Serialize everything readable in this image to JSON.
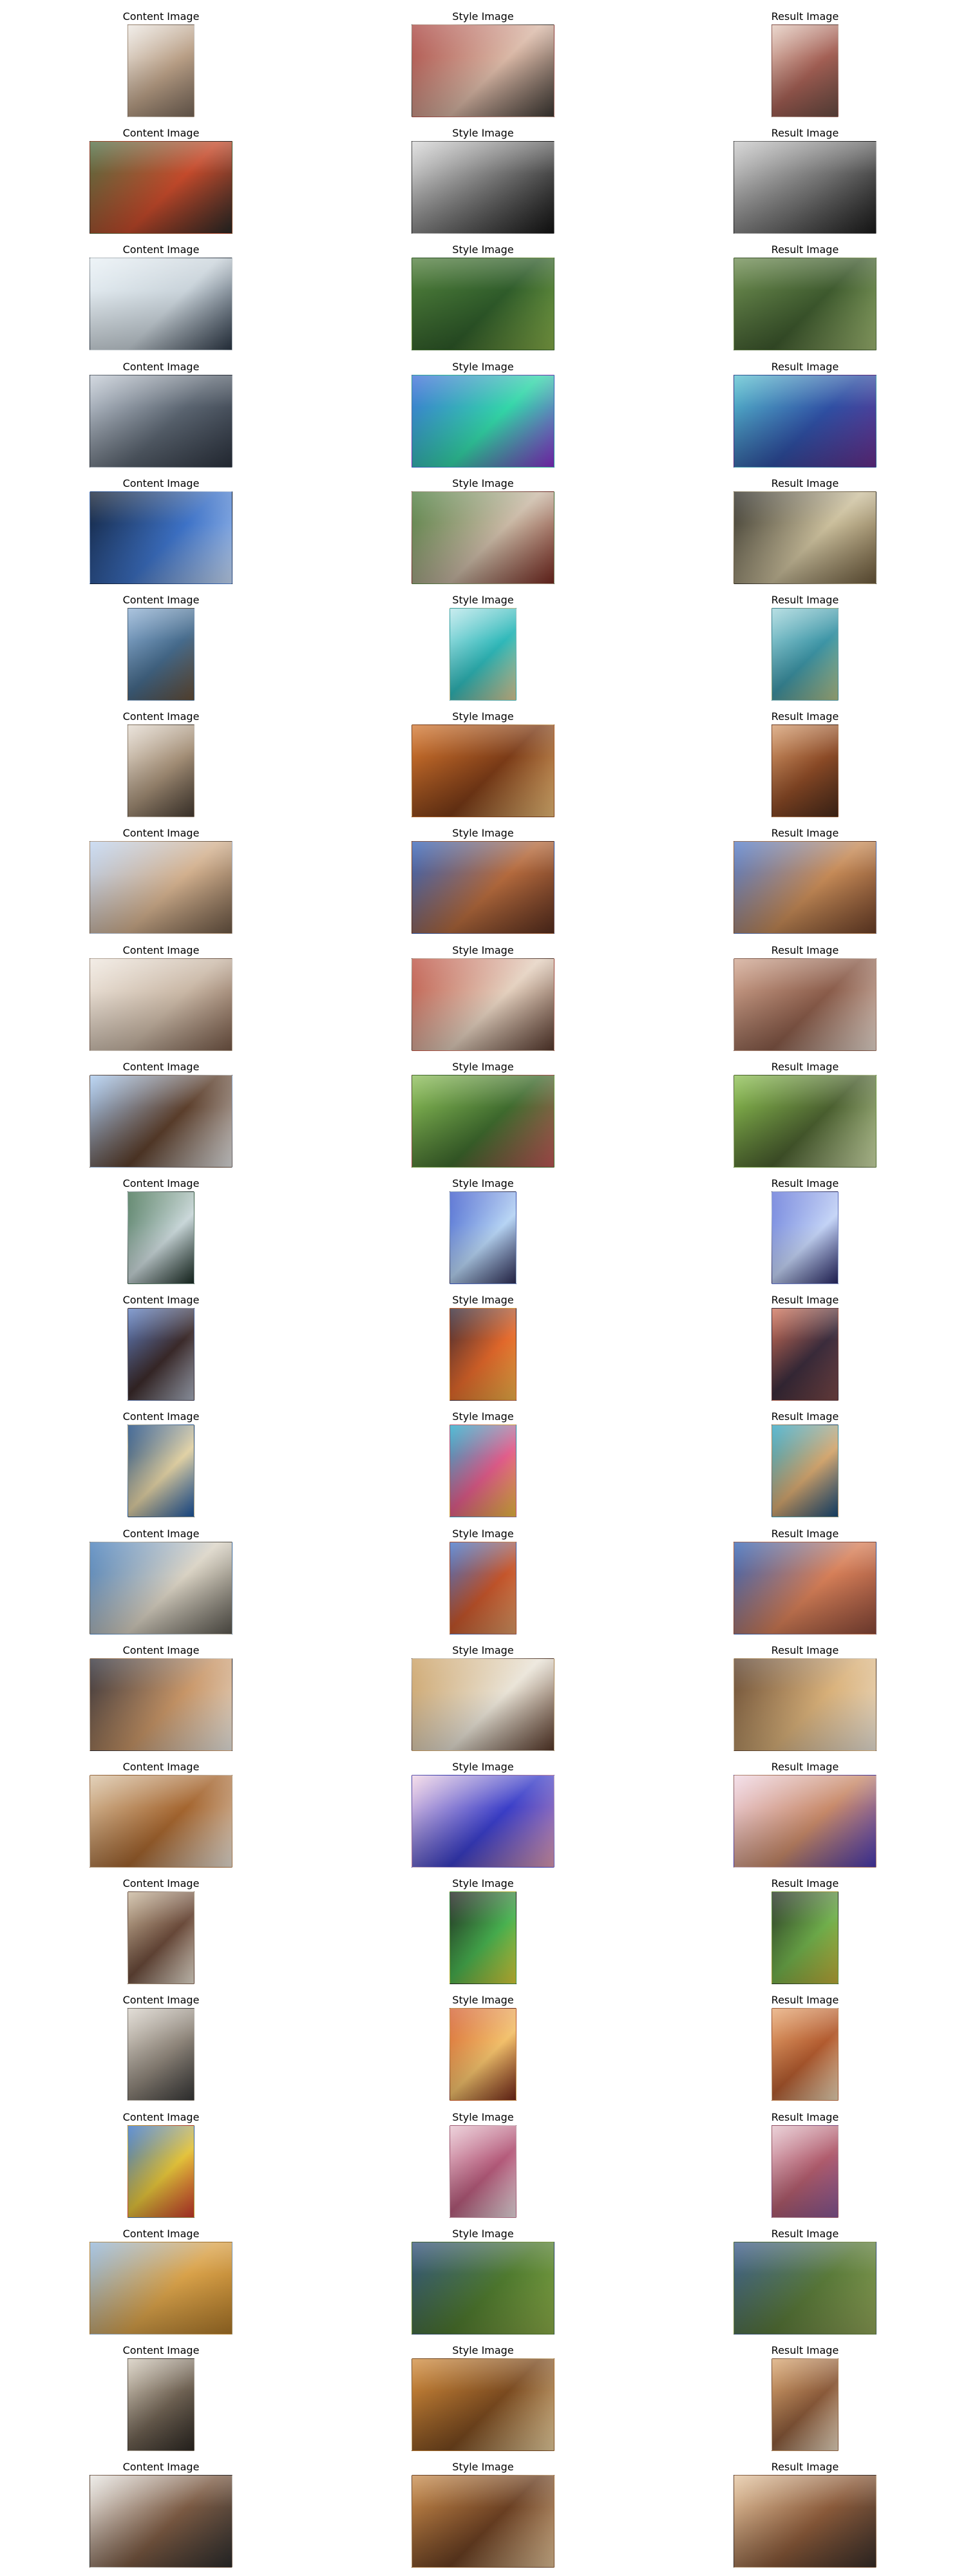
{
  "labels": {
    "content": "Content Image",
    "style": "Style Image",
    "result": "Result Image"
  },
  "rows": [
    {
      "content": {
        "shape": "portrait",
        "colors": [
          "#ece7e1",
          "#b99f86",
          "#7b6a5c"
        ]
      },
      "style": {
        "shape": "landscape",
        "colors": [
          "#a8433e",
          "#d9b7a5",
          "#3f3a35"
        ]
      },
      "result": {
        "shape": "portrait",
        "colors": [
          "#e3c9bc",
          "#a35f54",
          "#6a4d44"
        ]
      }
    },
    {
      "content": {
        "shape": "landscape",
        "colors": [
          "#4b6a3e",
          "#c44a2b",
          "#2b2a27"
        ]
      },
      "style": {
        "shape": "landscape",
        "colors": [
          "#d7d7d7",
          "#6c6c6c",
          "#141414"
        ]
      },
      "result": {
        "shape": "landscape",
        "colors": [
          "#c9c9c9",
          "#6f6f6f",
          "#1b1b1b"
        ]
      }
    },
    {
      "content": {
        "shape": "landscape",
        "colors": [
          "#e8f0f5",
          "#c9d3da",
          "#2f3b4a"
        ]
      },
      "style": {
        "shape": "landscape",
        "colors": [
          "#4f7d3a",
          "#2f5c2a",
          "#8ab24b"
        ]
      },
      "result": {
        "shape": "landscape",
        "colors": [
          "#6c8b4f",
          "#3e5a2e",
          "#a3bd75"
        ]
      }
    },
    {
      "content": {
        "shape": "landscape",
        "colors": [
          "#c3cbd5",
          "#5a6470",
          "#2d3440"
        ]
      },
      "style": {
        "shape": "landscape",
        "colors": [
          "#3b6bd8",
          "#33d6a8",
          "#8d2fd2"
        ]
      },
      "result": {
        "shape": "landscape",
        "colors": [
          "#58c0cf",
          "#2f4fa3",
          "#6b2f8f"
        ]
      }
    },
    {
      "content": {
        "shape": "landscape",
        "colors": [
          "#0e1b2f",
          "#3d72c7",
          "#cfe3ff"
        ]
      },
      "style": {
        "shape": "landscape",
        "colors": [
          "#4a7a3a",
          "#c9b8a4",
          "#7a2b22"
        ]
      },
      "result": {
        "shape": "landscape",
        "colors": [
          "#2b2a23",
          "#cbbf9c",
          "#6f5c3d"
        ]
      }
    },
    {
      "content": {
        "shape": "portrait",
        "colors": [
          "#8fb0d3",
          "#466b8c",
          "#6a523a"
        ]
      },
      "style": {
        "shape": "portrait",
        "colors": [
          "#b6e6ea",
          "#2fb8b9",
          "#e8d39a"
        ]
      },
      "result": {
        "shape": "portrait",
        "colors": [
          "#9fd4da",
          "#3d95a6",
          "#b9c88d"
        ]
      }
    },
    {
      "content": {
        "shape": "portrait",
        "colors": [
          "#e3dacf",
          "#a38e76",
          "#4a3f35"
        ]
      },
      "style": {
        "shape": "landscape",
        "colors": [
          "#d3762e",
          "#7b3b17",
          "#f1c17a"
        ]
      },
      "result": {
        "shape": "portrait",
        "colors": [
          "#d49a6b",
          "#8b4a26",
          "#4a2b1b"
        ]
      }
    },
    {
      "content": {
        "shape": "landscape",
        "colors": [
          "#bcd2ef",
          "#d2b08e",
          "#6f5a47"
        ]
      },
      "style": {
        "shape": "landscape",
        "colors": [
          "#2f5fb8",
          "#b46a3d",
          "#5a2f1f"
        ]
      },
      "result": {
        "shape": "landscape",
        "colors": [
          "#4f78c8",
          "#c58a57",
          "#6f4129"
        ]
      }
    },
    {
      "content": {
        "shape": "landscape",
        "colors": [
          "#efe7de",
          "#c9b7a5",
          "#7a5c4a"
        ]
      },
      "style": {
        "shape": "landscape",
        "colors": [
          "#b94a3a",
          "#e4d0be",
          "#5a3b2f"
        ]
      },
      "result": {
        "shape": "landscape",
        "colors": [
          "#d0a58f",
          "#8a5c4a",
          "#f0e1d6"
        ]
      }
    },
    {
      "content": {
        "shape": "landscape",
        "colors": [
          "#a7c9f0",
          "#5c3f2c",
          "#e9e9e9"
        ]
      },
      "style": {
        "shape": "landscape",
        "colors": [
          "#8bbd56",
          "#3f6b2e",
          "#c65a5a"
        ]
      },
      "result": {
        "shape": "landscape",
        "colors": [
          "#8bbf4f",
          "#4a5f2f",
          "#d7e6b0"
        ]
      }
    },
    {
      "content": {
        "shape": "portrait",
        "colors": [
          "#3b6a4a",
          "#c8d6d8",
          "#1b2e26"
        ]
      },
      "style": {
        "shape": "portrait",
        "colors": [
          "#3654c9",
          "#b6d4f4",
          "#2f2f5a"
        ]
      },
      "result": {
        "shape": "portrait",
        "colors": [
          "#5b6fd6",
          "#c3d3f6",
          "#2a2a6a"
        ]
      }
    },
    {
      "content": {
        "shape": "portrait",
        "colors": [
          "#5d7ec1",
          "#3b2a2a",
          "#b0b7c7"
        ]
      },
      "style": {
        "shape": "portrait",
        "colors": [
          "#2a1f2f",
          "#e2682b",
          "#f7b84b"
        ]
      },
      "result": {
        "shape": "portrait",
        "colors": [
          "#cf6f55",
          "#3b2c3c",
          "#7f4b4b"
        ]
      }
    },
    {
      "content": {
        "shape": "portrait",
        "colors": [
          "#0f3f7a",
          "#e0d0a3",
          "#1e5aa8"
        ]
      },
      "style": {
        "shape": "portrait",
        "colors": [
          "#1ea6c7",
          "#e05c8a",
          "#f2c243"
        ]
      },
      "result": {
        "shape": "portrait",
        "colors": [
          "#2aa2c2",
          "#d3a66f",
          "#1a4f7f"
        ]
      }
    },
    {
      "content": {
        "shape": "landscape",
        "colors": [
          "#3f78b7",
          "#d9d2c3",
          "#5d5a52"
        ]
      },
      "style": {
        "shape": "portrait",
        "colors": [
          "#3c6ec7",
          "#c4552b",
          "#e4a06a"
        ]
      },
      "result": {
        "shape": "landscape",
        "colors": [
          "#2f5fb3",
          "#d67f58",
          "#8c4a3a"
        ]
      }
    },
    {
      "content": {
        "shape": "landscape",
        "colors": [
          "#2a2a34",
          "#c89668",
          "#f1efe9"
        ]
      },
      "style": {
        "shape": "landscape",
        "colors": [
          "#c79a5a",
          "#e9e3d6",
          "#5a3a2a"
        ]
      },
      "result": {
        "shape": "landscape",
        "colors": [
          "#5a3f2b",
          "#d9b17a",
          "#f2ebdf"
        ]
      }
    },
    {
      "content": {
        "shape": "landscape",
        "colors": [
          "#d9c2a3",
          "#a4652f",
          "#efe7dc"
        ]
      },
      "style": {
        "shape": "landscape",
        "colors": [
          "#f1d3e4",
          "#3a3ec8",
          "#e6a0b8"
        ]
      },
      "result": {
        "shape": "landscape",
        "colors": [
          "#f0d6e3",
          "#c88a6a",
          "#4b3bb8"
        ]
      }
    },
    {
      "content": {
        "shape": "portrait",
        "colors": [
          "#c7b59a",
          "#6a4a3a",
          "#f0e7d8"
        ]
      },
      "style": {
        "shape": "portrait",
        "colors": [
          "#1a1a1a",
          "#47b04f",
          "#e0d23a"
        ]
      },
      "result": {
        "shape": "portrait",
        "colors": [
          "#1f2a1f",
          "#6fae4b",
          "#c7b13a"
        ]
      }
    },
    {
      "content": {
        "shape": "portrait",
        "colors": [
          "#d8d2c9",
          "#8e857a",
          "#3a3a3a"
        ]
      },
      "style": {
        "shape": "portrait",
        "colors": [
          "#d35b2b",
          "#f2c06b",
          "#7a2a1a"
        ]
      },
      "result": {
        "shape": "portrait",
        "colors": [
          "#e6a56f",
          "#b25b2f",
          "#f4dfbe"
        ]
      }
    },
    {
      "content": {
        "shape": "portrait",
        "colors": [
          "#2f6ec7",
          "#e2c23a",
          "#d13b2f"
        ]
      },
      "style": {
        "shape": "portrait",
        "colors": [
          "#e7c3cf",
          "#b45a7a",
          "#f3e6ea"
        ]
      },
      "result": {
        "shape": "portrait",
        "colors": [
          "#e4c2cb",
          "#b05c6d",
          "#8a5a9a"
        ]
      }
    },
    {
      "content": {
        "shape": "landscape",
        "colors": [
          "#8fb4d9",
          "#d9a24a",
          "#b07a2a"
        ]
      },
      "style": {
        "shape": "landscape",
        "colors": [
          "#2f4f7a",
          "#4f7a2f",
          "#8fb04a"
        ]
      },
      "result": {
        "shape": "landscape",
        "colors": [
          "#3a5a8a",
          "#5a7a3a",
          "#94a85a"
        ]
      }
    },
    {
      "content": {
        "shape": "portrait",
        "colors": [
          "#d3cabb",
          "#6f6253",
          "#2f2a25"
        ]
      },
      "style": {
        "shape": "landscape",
        "colors": [
          "#d08a3a",
          "#7a4a1f",
          "#f1d6a3"
        ]
      },
      "result": {
        "shape": "portrait",
        "colors": [
          "#d8a56f",
          "#8a5a3a",
          "#f2e0c7"
        ]
      }
    },
    {
      "content": {
        "shape": "landscape",
        "colors": [
          "#e8e6e2",
          "#7b5a43",
          "#2f2f2f"
        ]
      },
      "style": {
        "shape": "landscape",
        "colors": [
          "#c78a4a",
          "#6a3f22",
          "#e8c69a"
        ]
      },
      "result": {
        "shape": "landscape",
        "colors": [
          "#e4c49f",
          "#8a5a3a",
          "#3a2f2a"
        ]
      }
    }
  ]
}
